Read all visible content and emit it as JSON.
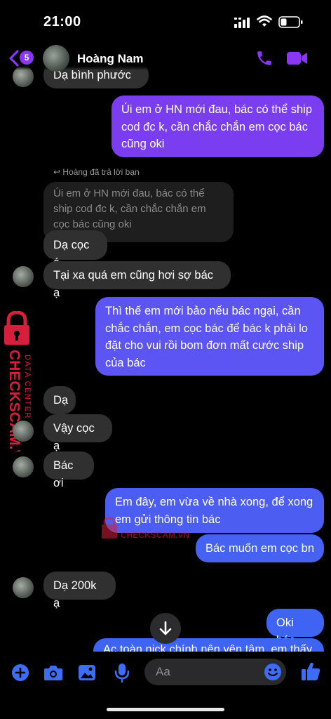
{
  "status": {
    "time": "21:00"
  },
  "header": {
    "badge": "5",
    "name": "Hoàng Nam"
  },
  "messages": {
    "partial_top": "Dạ bình phước",
    "m1": "Úi em ở HN mới đau, bác có thể ship cod đc k, cần chắc chắn em cọc bác cũng oki",
    "replied_label": "Hoàng đã trả lời bạn",
    "quoted": "Úi em ở HN mới đau, bác có thể ship cod đc k, cần chắc chắn em cọc bác cũng oki",
    "m2": "Dạ cọc á",
    "m3": "Tại xa quá em cũng hơi sợ bác ạ",
    "m4": "Thì thế em mới bảo nếu bác ngại, cần chắc chắn, em cọc bác để bác k phải lo đặt cho vui rồi bom đơn mất cước ship của bác",
    "m5": "Dạ",
    "m6": "Vậy cọc ạ",
    "m7": "Bác ơi",
    "m8": "Em đây, em vừa về nhà xong, để xong em gửi thông tin bác",
    "m9": "Bác muốn em cọc bn",
    "m10": "Dạ 200k ạ",
    "m11": "Oki bác",
    "m12_partial": "Ac toàn nick chính nên yên tâm, em thấy"
  },
  "watermark": {
    "line1": "CHECKSCAM.VN",
    "line2": "DATA CENTER"
  },
  "composer": {
    "placeholder": "Aa"
  },
  "colors": {
    "accent": "#8a36f5",
    "outgoing_top": "#7b3cf0",
    "outgoing_mid": "#5a52f2",
    "outgoing_bottom": "#3f63f2",
    "incoming": "#303030",
    "watermark": "#d61f3c"
  }
}
